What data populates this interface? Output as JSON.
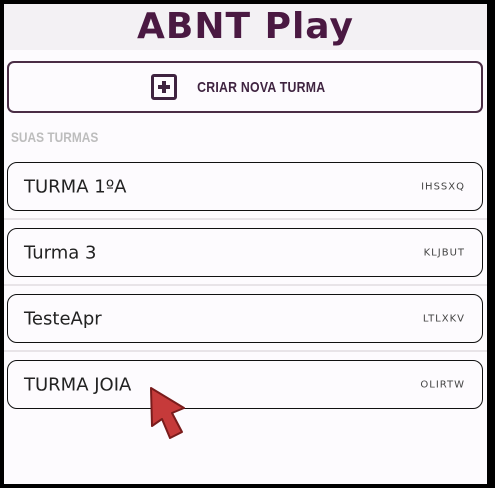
{
  "app": {
    "title": "ABNT Play"
  },
  "actions": {
    "create_class_label": "CRIAR NOVA TURMA"
  },
  "section": {
    "title": "SUAS TURMAS"
  },
  "classes": [
    {
      "name": "TURMA 1ºA",
      "code": "IHSSXQ"
    },
    {
      "name": "Turma 3",
      "code": "KLJBUT"
    },
    {
      "name": "TesteApr",
      "code": "LTLXKV"
    },
    {
      "name": "TURMA JOIA",
      "code": "OLIRTW"
    }
  ],
  "colors": {
    "brand": "#4a1942",
    "header_bg": "#f3f1f4",
    "page_bg": "#fdfbfe",
    "cursor": "#c63a3a"
  },
  "icons": {
    "create": "plus-square-icon",
    "pointer": "mouse-cursor-icon"
  }
}
